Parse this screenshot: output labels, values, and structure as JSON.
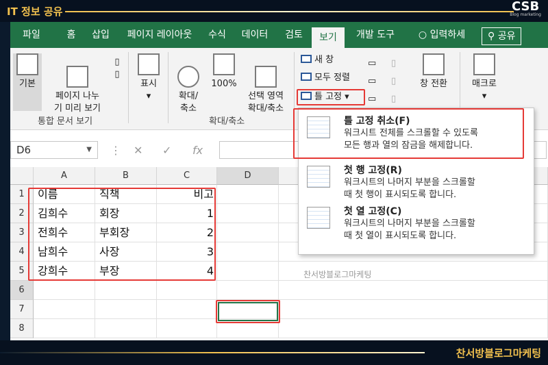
{
  "banner": {
    "title": "IT 정보 공유",
    "logo": "CSB",
    "logo_sub": "Blog marketing",
    "brand": "찬서방블로그마케팅"
  },
  "tabs": [
    "파일",
    "홈",
    "삽입",
    "페이지 레이아웃",
    "수식",
    "데이터",
    "검토",
    "보기",
    "개발 도구",
    "입력하세",
    "공유"
  ],
  "ribbon": {
    "basic": "기본",
    "page_break": "페이지 나누\n기 미리 보기",
    "show": "표시",
    "zoom": "확대/\n축소",
    "zoom100": "100%",
    "zoom_sel": "선택 영역\n확대/축소",
    "new_window": "새 창",
    "arrange_all": "모두 정렬",
    "freeze": "틀 고정",
    "switch": "창 전환",
    "macro": "매크로",
    "group_views": "통합 문서 보기",
    "group_zoom": "확대/축소"
  },
  "formula_bar": {
    "namebox": "D6",
    "fx": "fx"
  },
  "columns": [
    "A",
    "B",
    "C",
    "D"
  ],
  "rows": [
    [
      "이름",
      "직책",
      "비고"
    ],
    [
      "김희수",
      "회장",
      "1"
    ],
    [
      "전희수",
      "부회장",
      "2"
    ],
    [
      "남희수",
      "사장",
      "3"
    ],
    [
      "강희수",
      "부장",
      "4"
    ],
    [
      "",
      "",
      ""
    ],
    [
      "",
      "",
      ""
    ],
    [
      "",
      "",
      ""
    ]
  ],
  "watermark": "찬서방블로그마케팅",
  "menu": [
    {
      "title": "틀 고정 취소(F)",
      "desc": "워크시트 전체를 스크롤할 수 있도록\n모든 행과 열의 잠금을 해제합니다."
    },
    {
      "title": "첫 행 고정(R)",
      "desc": "워크시트의 나머지 부분을 스크롤할\n때 첫 행이 표시되도록 합니다."
    },
    {
      "title": "첫 열 고정(C)",
      "desc": "워크시트의 나머지 부분을 스크롤할\n때 첫 열이 표시되도록 합니다."
    }
  ],
  "colors": {
    "excel_green": "#217346",
    "highlight": "#e53935",
    "banner_gold": "#f2c14e"
  }
}
